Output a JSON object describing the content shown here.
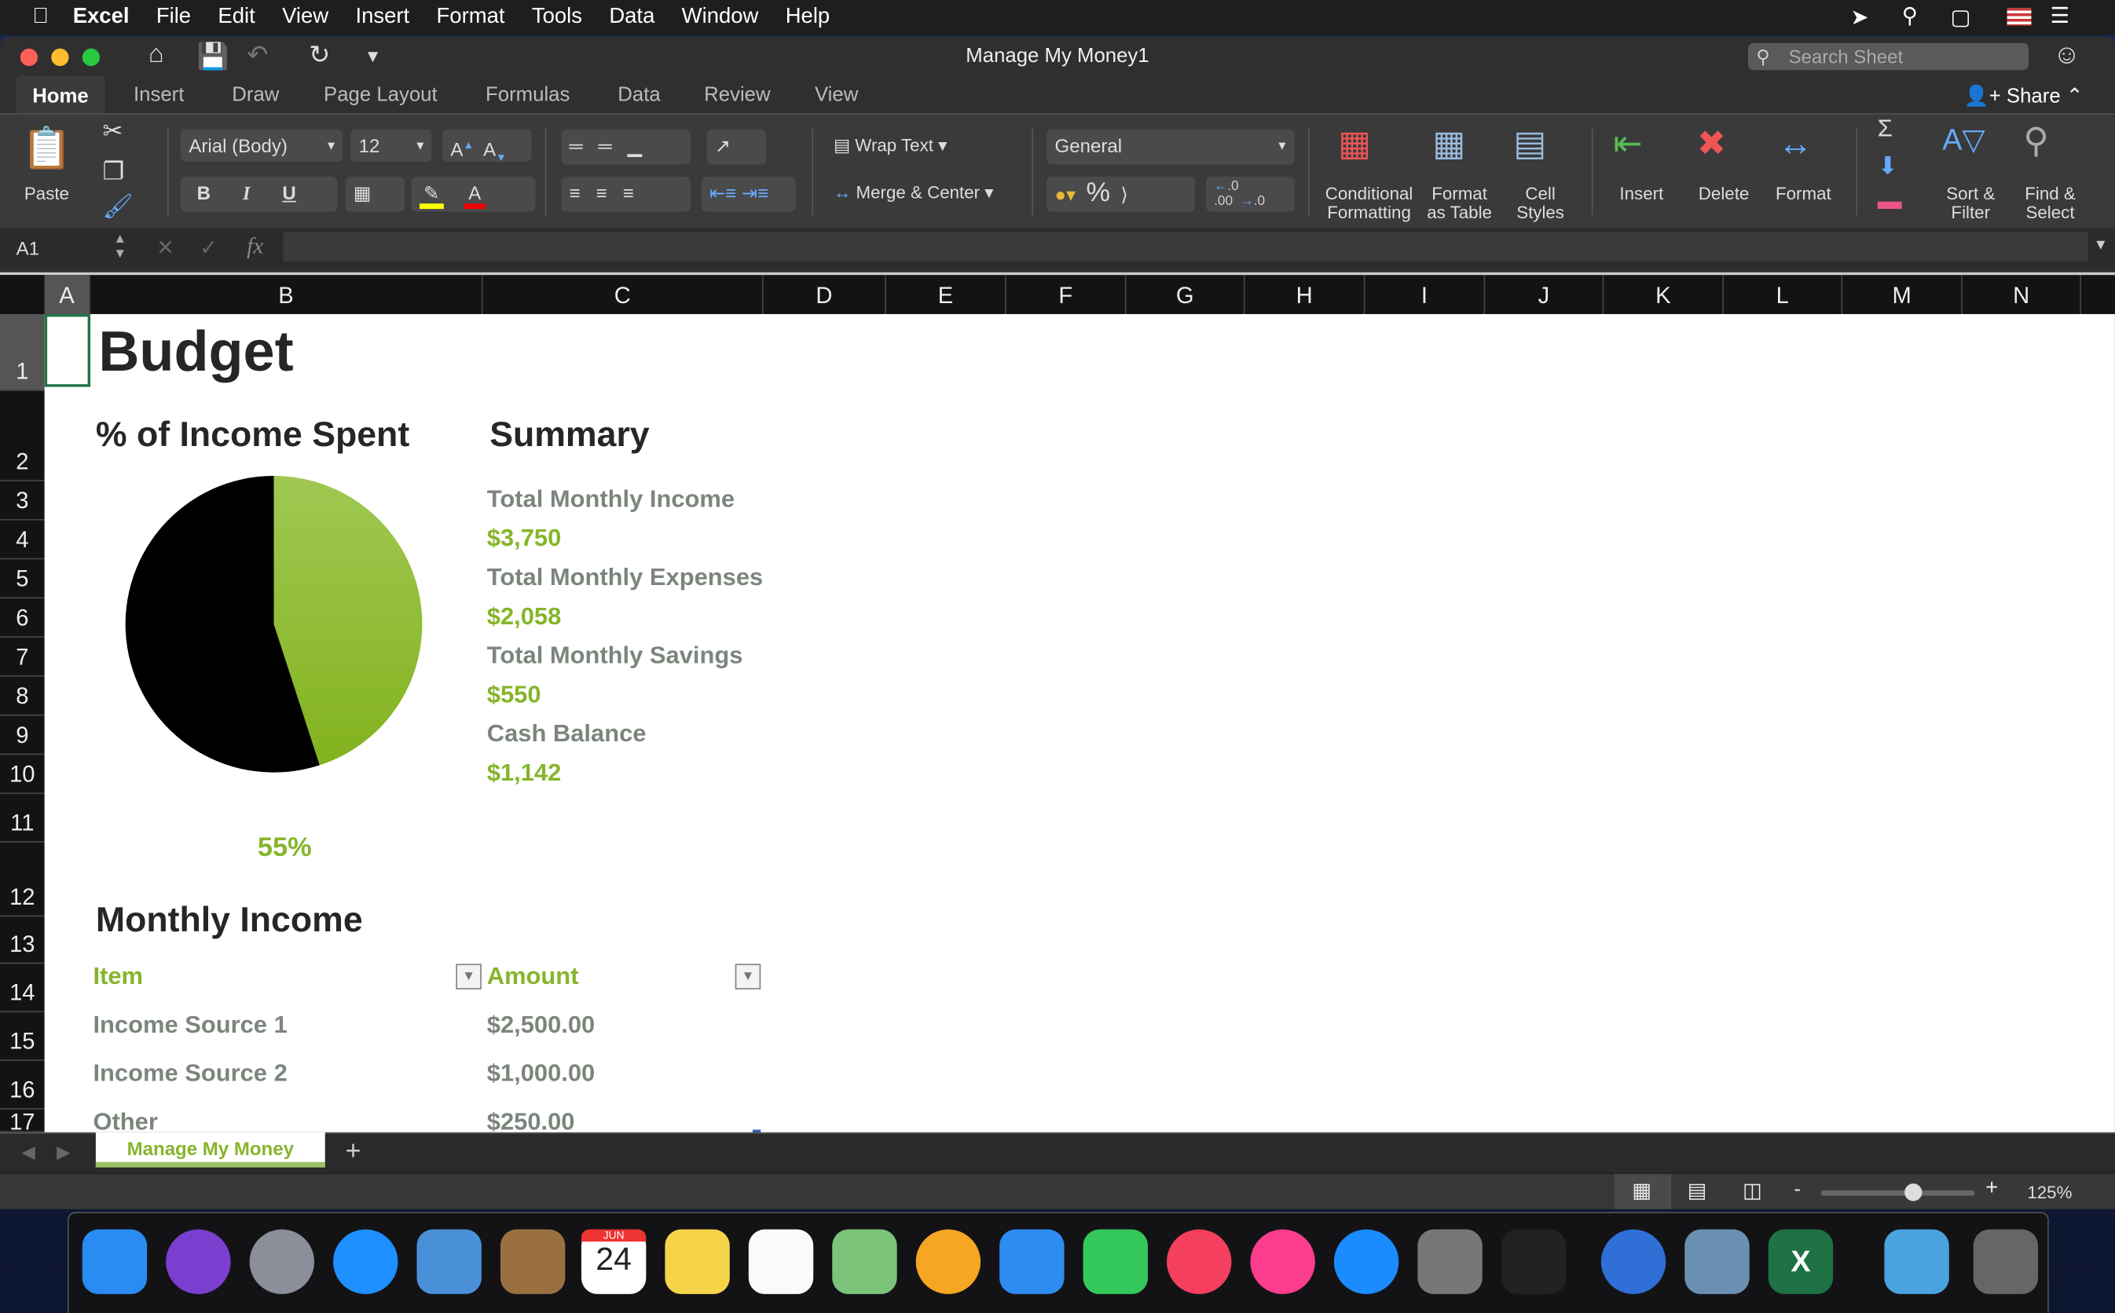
{
  "menubar": {
    "app": "Excel",
    "items": [
      "File",
      "Edit",
      "View",
      "Insert",
      "Format",
      "Tools",
      "Data",
      "Window",
      "Help"
    ]
  },
  "window": {
    "title": "Manage My Money1",
    "search_placeholder": "Search Sheet",
    "share": "Share"
  },
  "ribbon_tabs": [
    "Home",
    "Insert",
    "Draw",
    "Page Layout",
    "Formulas",
    "Data",
    "Review",
    "View"
  ],
  "ribbon": {
    "paste": "Paste",
    "font": "Arial (Body)",
    "size": "12",
    "bold": "B",
    "italic": "I",
    "underline": "U",
    "wrap": "Wrap Text",
    "merge": "Merge & Center",
    "number_format": "General",
    "percent": "%",
    "cond": "Conditional Formatting",
    "fmt_table": "Format as Table",
    "cell_styles": "Cell Styles",
    "insert": "Insert",
    "delete": "Delete",
    "format": "Format",
    "sort": "Sort & Filter",
    "find": "Find & Select"
  },
  "formula_bar": {
    "cell_ref": "A1",
    "fx": "fx",
    "content": ""
  },
  "columns": [
    "A",
    "B",
    "C",
    "D",
    "E",
    "F",
    "G",
    "H",
    "I",
    "J",
    "K",
    "L",
    "M",
    "N"
  ],
  "rows": [
    "1",
    "2",
    "3",
    "4",
    "5",
    "6",
    "7",
    "8",
    "9",
    "10",
    "11",
    "12",
    "13",
    "14",
    "15",
    "16",
    "17"
  ],
  "sheet": {
    "title": "Budget",
    "chart_title": "% of Income Spent",
    "summary_title": "Summary",
    "summary": [
      {
        "label": "Total Monthly Income",
        "value": "$3,750"
      },
      {
        "label": "Total Monthly Expenses",
        "value": "$2,058"
      },
      {
        "label": "Total Monthly Savings",
        "value": "$550"
      },
      {
        "label": "Cash Balance",
        "value": "$1,142"
      }
    ],
    "income_title": "Monthly Income",
    "income_headers": [
      "Item",
      "Amount"
    ],
    "income_rows": [
      {
        "item": "Income Source 1",
        "amount": "$2,500.00"
      },
      {
        "item": "Income Source 2",
        "amount": "$1,000.00"
      },
      {
        "item": "Other",
        "amount": "$250.00"
      }
    ]
  },
  "chart_data": {
    "type": "pie",
    "values": [
      55,
      45
    ],
    "colors": [
      "#000000",
      "#8cbb2a"
    ],
    "data_label": "55%",
    "title": "% of Income Spent"
  },
  "sheet_tabs": [
    "Manage My Money"
  ],
  "status": {
    "zoom": "125%",
    "zoom_fraction": 0.6
  },
  "colors": {
    "accent": "#86b52b",
    "label": "#7c857c"
  },
  "dock": {
    "calendar_month": "JUN",
    "calendar_day": "24"
  }
}
